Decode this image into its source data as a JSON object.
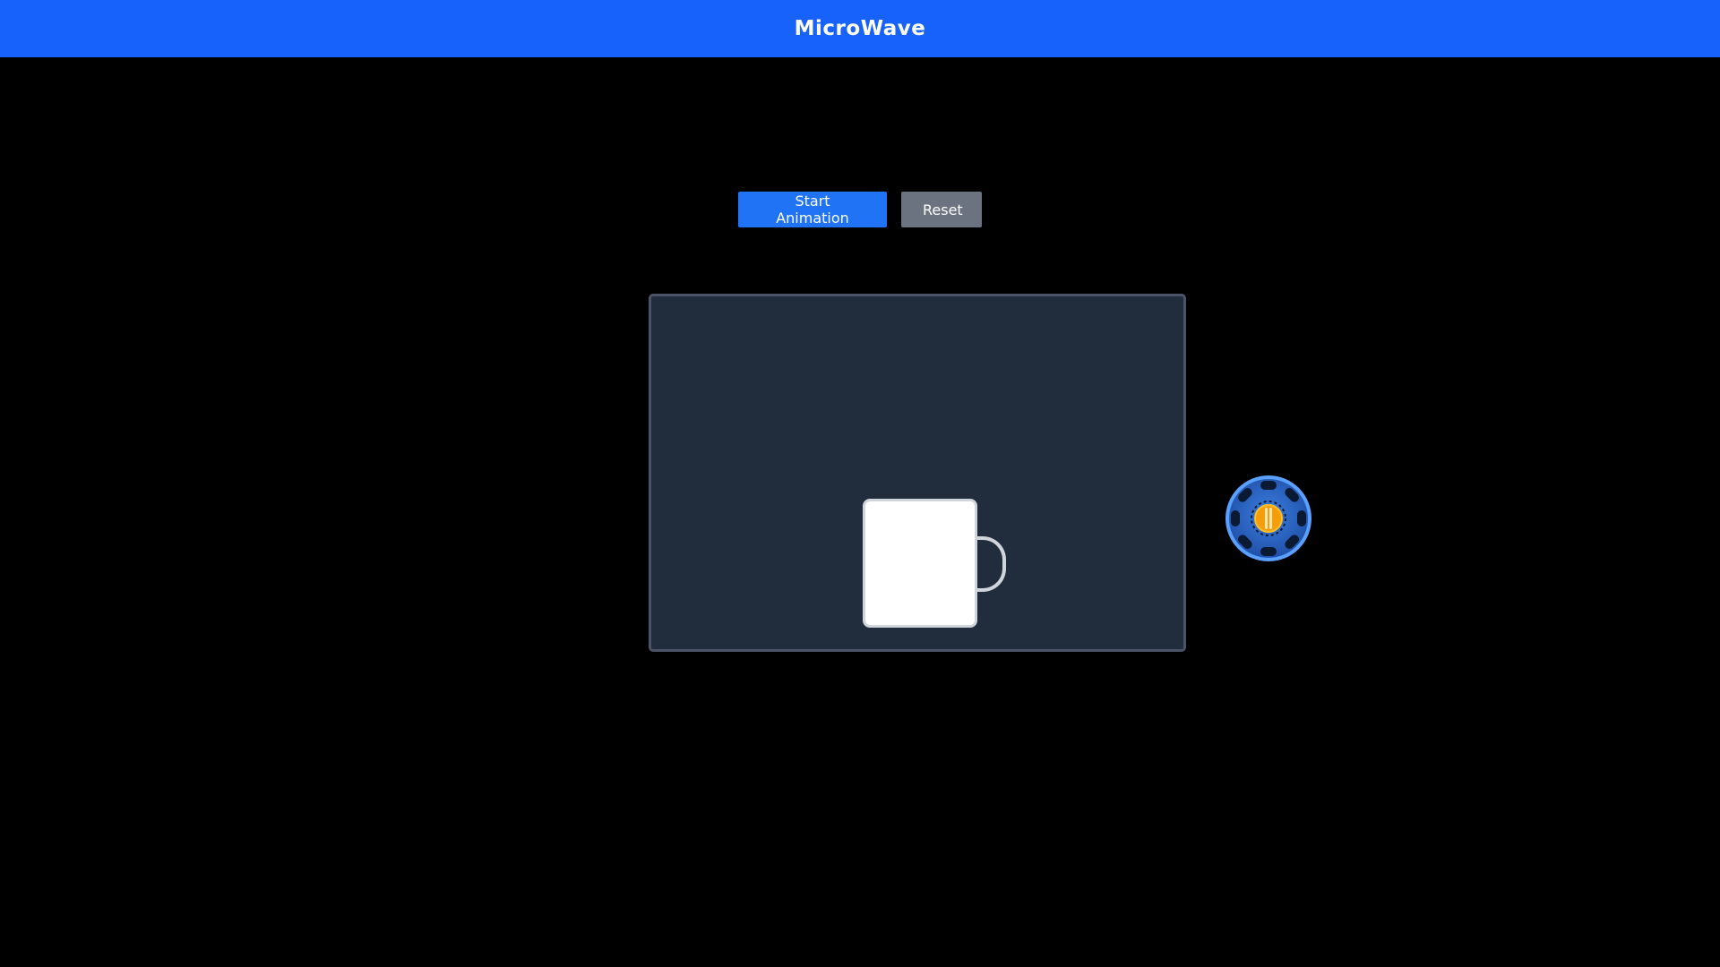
{
  "header": {
    "title": "MicroWave",
    "background_color": "#1762fb"
  },
  "controls": {
    "start_label": "Start Animation",
    "reset_label": "Reset",
    "start_color": "#2173f5",
    "reset_color": "#6b7280"
  },
  "chamber": {
    "background_color": "#212c3d",
    "border_color": "#4a5466",
    "item": "mug"
  },
  "dial": {
    "icon": "dial-icon",
    "accent_color": "#3b82f6",
    "center_color": "#f59e0b"
  }
}
